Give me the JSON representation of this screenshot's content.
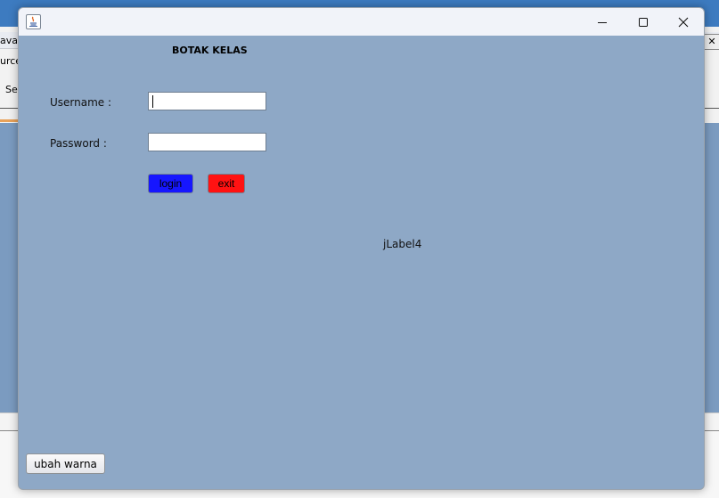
{
  "background": {
    "fragments": [
      "ava",
      "urce",
      "Sel"
    ],
    "close_glyph": "✕"
  },
  "window": {
    "title": "",
    "icon": "java-icon",
    "controls": {
      "minimize": "minimize-icon",
      "maximize": "maximize-icon",
      "close": "close-icon"
    }
  },
  "form": {
    "heading": "BOTAK KELAS",
    "username_label": "Username :",
    "password_label": "Password :",
    "username_value": "",
    "password_value": "",
    "login_label": "login",
    "exit_label": "exit",
    "status_label": "jLabel4",
    "color_button_label": "ubah warna"
  },
  "colors": {
    "panel": "#8ea8c6",
    "login_button": "#1616ff",
    "exit_button": "#ff1212"
  }
}
